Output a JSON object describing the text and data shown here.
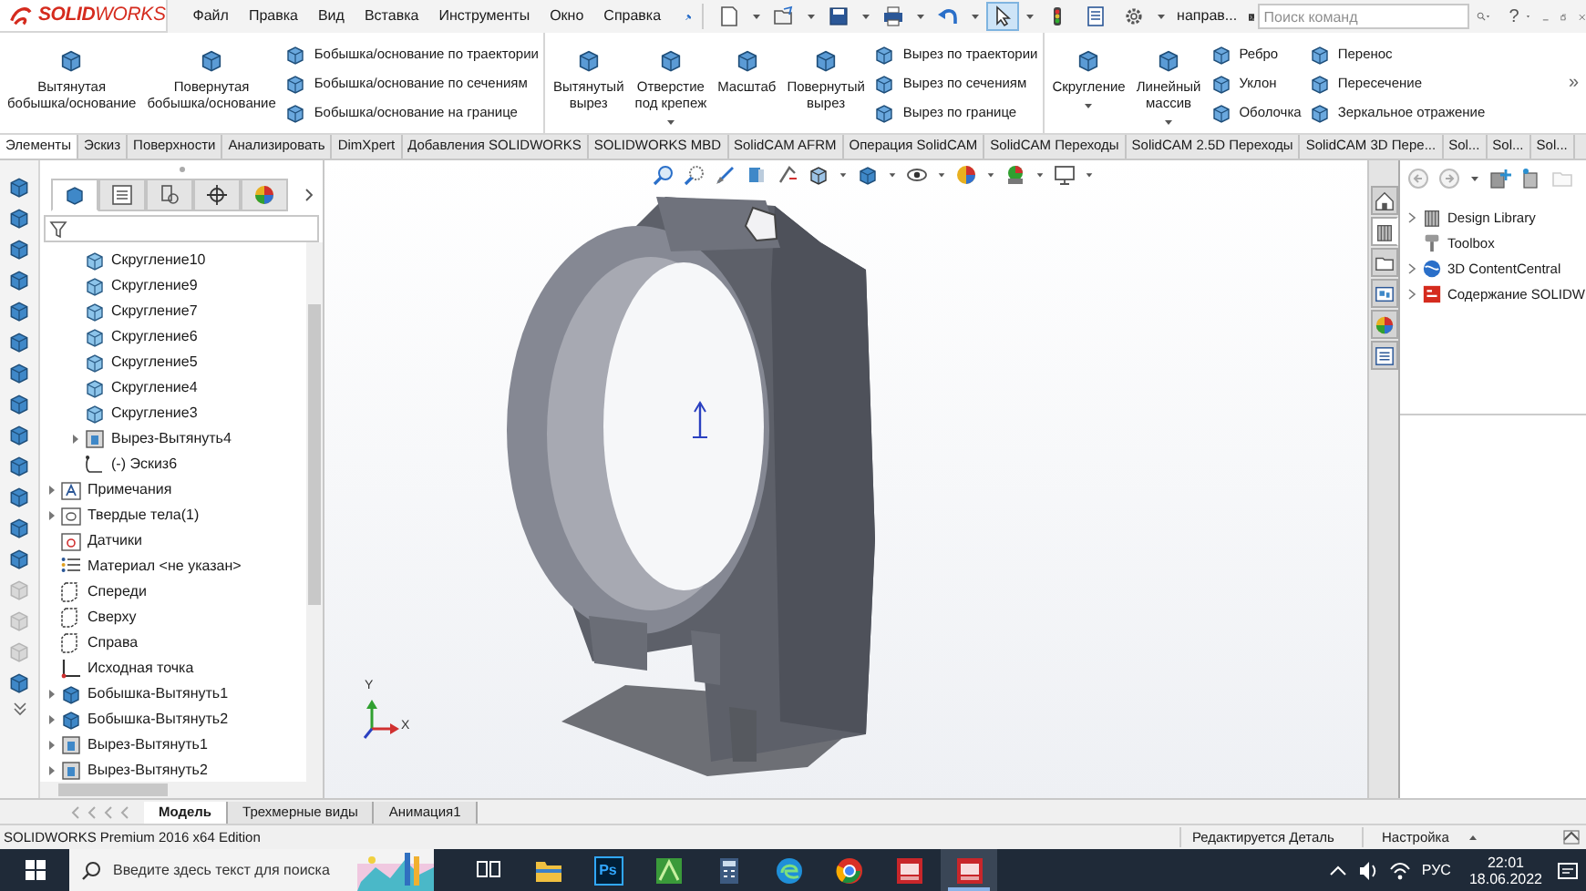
{
  "app": {
    "logo": "**SOLID**WORKS"
  },
  "menu": [
    "Файл",
    "Правка",
    "Вид",
    "Вставка",
    "Инструменты",
    "Окно",
    "Справка"
  ],
  "toolbar": {
    "buttons": [
      {
        "kind": "new",
        "selected": false
      },
      {
        "kind": "open",
        "selected": false
      },
      {
        "kind": "save",
        "selected": false
      },
      {
        "kind": "print",
        "selected": false
      },
      {
        "kind": "undo",
        "selected": false
      },
      {
        "kind": "select",
        "selected": true
      },
      {
        "kind": "rebuild",
        "selected": false
      },
      {
        "kind": "file_properties",
        "selected": false
      },
      {
        "kind": "options",
        "selected": false
      }
    ],
    "view_label": "направ...",
    "search": {
      "placeholder": "Поиск команд"
    },
    "help": "?"
  },
  "ribbon": {
    "groups": [
      {
        "items": [
          {
            "kind": "large",
            "lines": [
              "Вытянутая",
              "бобышка/основание"
            ],
            "dropdown": false
          },
          {
            "kind": "large",
            "lines": [
              "Повернутая",
              "бобышка/основание"
            ],
            "dropdown": false
          },
          {
            "kind": "stack",
            "items": [
              "Бобышка/основание по траектории",
              "Бобышка/основание по сечениям",
              "Бобышка/основание на границе"
            ]
          }
        ]
      },
      {
        "items": [
          {
            "kind": "large",
            "lines": [
              "Вытянутый",
              "вырез"
            ],
            "dropdown": false
          },
          {
            "kind": "large",
            "lines": [
              "Отверстие",
              "под крепеж"
            ],
            "dropdown": true
          },
          {
            "kind": "large",
            "lines": [
              "Масштаб"
            ],
            "dropdown": false
          },
          {
            "kind": "large",
            "lines": [
              "Повернутый",
              "вырез"
            ],
            "dropdown": false
          },
          {
            "kind": "stack",
            "items": [
              "Вырез по траектории",
              "Вырез по сечениям",
              "Вырез по границе"
            ]
          }
        ]
      },
      {
        "items": [
          {
            "kind": "large",
            "lines": [
              "Скругление"
            ],
            "dropdown": true
          },
          {
            "kind": "large",
            "lines": [
              "Линейный",
              "массив"
            ],
            "dropdown": true
          },
          {
            "kind": "stack",
            "items": [
              "Ребро",
              "Уклон",
              "Оболочка"
            ]
          },
          {
            "kind": "stack",
            "items": [
              "Перенос",
              "Пересечение",
              "Зеркальное отражение"
            ]
          }
        ]
      }
    ],
    "more": "»"
  },
  "tabs": [
    {
      "label": "Элементы",
      "selected": true
    },
    {
      "label": "Эскиз",
      "selected": false
    },
    {
      "label": "Поверхности",
      "selected": false
    },
    {
      "label": "Анализировать",
      "selected": false
    },
    {
      "label": "DimXpert",
      "selected": false
    },
    {
      "label": "Добавления SOLIDWORKS",
      "selected": false
    },
    {
      "label": "SOLIDWORKS MBD",
      "selected": false
    },
    {
      "label": "SolidCAM AFRM",
      "selected": false
    },
    {
      "label": "Операция  SolidCAM",
      "selected": false
    },
    {
      "label": "SolidCAM Переходы",
      "selected": false
    },
    {
      "label": "SolidCAM 2.5D Переходы",
      "selected": false
    },
    {
      "label": "SolidCAM 3D Пере...",
      "selected": false
    },
    {
      "label": "Sol...",
      "selected": false
    },
    {
      "label": "Sol...",
      "selected": false
    },
    {
      "label": "Sol...",
      "selected": false
    }
  ],
  "side_toolbar": [
    {
      "disabled": false
    },
    {
      "disabled": false
    },
    {
      "disabled": false
    },
    {
      "disabled": false
    },
    {
      "disabled": false
    },
    {
      "disabled": false
    },
    {
      "disabled": false
    },
    {
      "disabled": false
    },
    {
      "disabled": false
    },
    {
      "disabled": false
    },
    {
      "disabled": false
    },
    {
      "disabled": false
    },
    {
      "disabled": false
    },
    {
      "disabled": true
    },
    {
      "disabled": true
    },
    {
      "disabled": true
    },
    {
      "disabled": false
    }
  ],
  "feature_manager": {
    "tabs": [
      {
        "selected": true
      },
      {
        "selected": false
      },
      {
        "selected": false
      },
      {
        "selected": false
      },
      {
        "selected": false
      }
    ],
    "nested_items": [
      {
        "label": "Скругление10",
        "kind": "fillet",
        "expander": false
      },
      {
        "label": "Скругление9",
        "kind": "fillet",
        "expander": false
      },
      {
        "label": "Скругление7",
        "kind": "fillet",
        "expander": false
      },
      {
        "label": "Скругление6",
        "kind": "fillet",
        "expander": false
      },
      {
        "label": "Скругление5",
        "kind": "fillet",
        "expander": false
      },
      {
        "label": "Скругление4",
        "kind": "fillet",
        "expander": false
      },
      {
        "label": "Скругление3",
        "kind": "fillet",
        "expander": false
      },
      {
        "label": "Вырез-Вытянуть4",
        "kind": "cut",
        "expander": true
      },
      {
        "label": "(-) Эскиз6",
        "kind": "sketch",
        "expander": false
      }
    ],
    "items": [
      {
        "label": "Примечания",
        "kind": "annotations",
        "expander": true
      },
      {
        "label": "Твердые тела(1)",
        "kind": "solids",
        "expander": true
      },
      {
        "label": "Датчики",
        "kind": "sensors",
        "expander": false
      },
      {
        "label": "Материал <не указан>",
        "kind": "material",
        "expander": false
      },
      {
        "label": "Спереди",
        "kind": "plane",
        "expander": false
      },
      {
        "label": "Сверху",
        "kind": "plane",
        "expander": false
      },
      {
        "label": "Справа",
        "kind": "plane",
        "expander": false
      },
      {
        "label": "Исходная точка",
        "kind": "origin",
        "expander": false
      },
      {
        "label": "Бобышка-Вытянуть1",
        "kind": "boss",
        "expander": true
      },
      {
        "label": "Бобышка-Вытянуть2",
        "kind": "boss",
        "expander": true
      },
      {
        "label": "Вырез-Вытянуть1",
        "kind": "cut",
        "expander": true
      },
      {
        "label": "Вырез-Вытянуть2",
        "kind": "cut",
        "expander": true
      }
    ]
  },
  "viewport": {
    "triad_labels": [
      "Y",
      "X"
    ]
  },
  "task_pane": {
    "tabs": [
      {
        "selected": false
      },
      {
        "selected": true
      },
      {
        "selected": false
      },
      {
        "selected": false
      },
      {
        "selected": false
      },
      {
        "selected": false
      }
    ],
    "items": [
      {
        "label": "Design Library",
        "expander": true
      },
      {
        "label": "Toolbox",
        "expander": false
      },
      {
        "label": "3D ContentCentral",
        "expander": true
      },
      {
        "label": "Содержание SOLIDW",
        "expander": true
      }
    ]
  },
  "bottom_tabs": [
    {
      "label": "Модель",
      "selected": true
    },
    {
      "label": "Трехмерные виды",
      "selected": false
    },
    {
      "label": "Анимация1",
      "selected": false
    }
  ],
  "status_bar": {
    "edition": "SOLIDWORKS Premium 2016 x64 Edition",
    "mode": "Редактируется Деталь",
    "units": "Настройка"
  },
  "taskbar": {
    "search": {
      "placeholder": "Введите здесь текст для поиска"
    },
    "apps": [
      {
        "kind": "task_view",
        "selected": false
      },
      {
        "kind": "explorer",
        "selected": false
      },
      {
        "kind": "photoshop",
        "label": "Ps",
        "selected": false
      },
      {
        "kind": "green_app",
        "selected": false
      },
      {
        "kind": "calculator",
        "selected": false
      },
      {
        "kind": "edge",
        "selected": false
      },
      {
        "kind": "chrome",
        "selected": false
      },
      {
        "kind": "solidworks",
        "selected": false
      },
      {
        "kind": "solidworks",
        "selected": true
      }
    ],
    "language": "РУС",
    "time": "22:01",
    "date": "18.06.2022"
  }
}
